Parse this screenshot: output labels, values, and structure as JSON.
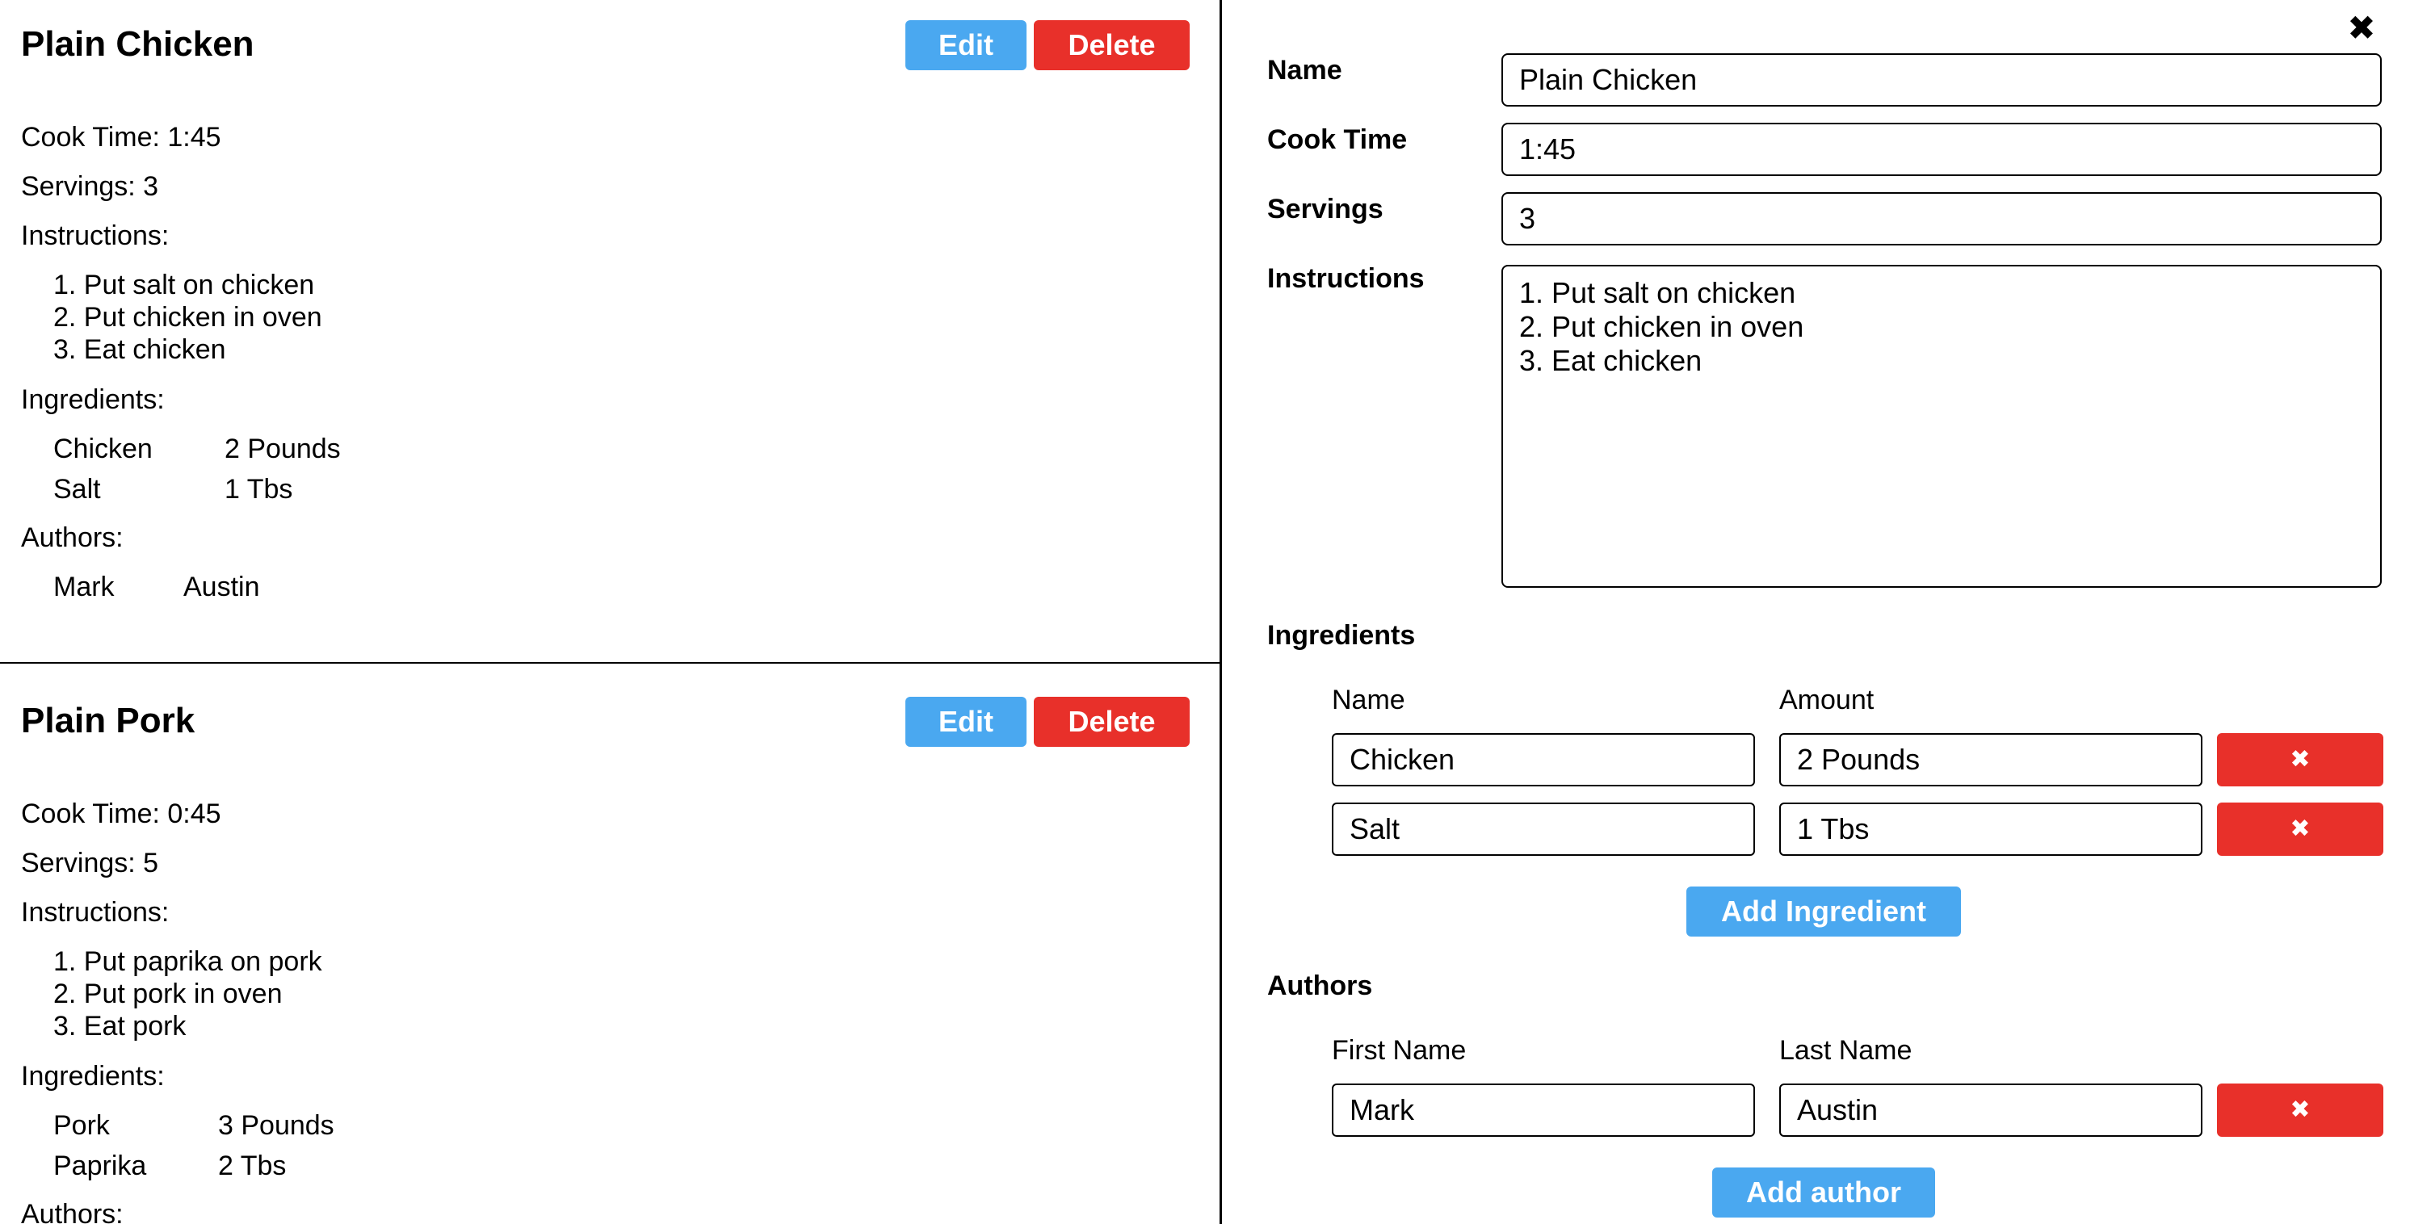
{
  "recipes": [
    {
      "title": "Plain Chicken",
      "edit_label": "Edit",
      "delete_label": "Delete",
      "cook_time": "Cook Time: 1:45",
      "servings": "Servings: 3",
      "instructions_label": "Instructions:",
      "steps": [
        "1. Put salt on chicken",
        "2. Put chicken in oven",
        "3. Eat chicken"
      ],
      "ingredients_label": "Ingredients:",
      "ingredients": [
        {
          "name": "Chicken",
          "amount": "2 Pounds"
        },
        {
          "name": "Salt",
          "amount": "1 Tbs"
        }
      ],
      "authors_label": "Authors:",
      "authors": [
        {
          "first": "Mark",
          "last": "Austin"
        }
      ]
    },
    {
      "title": "Plain Pork",
      "edit_label": "Edit",
      "delete_label": "Delete",
      "cook_time": "Cook Time: 0:45",
      "servings": "Servings: 5",
      "instructions_label": "Instructions:",
      "steps": [
        "1. Put paprika on pork",
        "2. Put pork in oven",
        "3. Eat pork"
      ],
      "ingredients_label": "Ingredients:",
      "ingredients": [
        {
          "name": "Pork",
          "amount": "3 Pounds"
        },
        {
          "name": "Paprika",
          "amount": "2 Tbs"
        }
      ],
      "authors_label": "Authors:"
    }
  ],
  "edit_form": {
    "close_icon": "✖",
    "name_label": "Name",
    "name_value": "Plain Chicken",
    "cook_time_label": "Cook Time",
    "cook_time_value": "1:45",
    "servings_label": "Servings",
    "servings_value": "3",
    "instructions_label": "Instructions",
    "instructions_value": "1. Put salt on chicken\n2. Put chicken in oven\n3. Eat chicken",
    "ingredients_section": "Ingredients",
    "ingredient_name_header": "Name",
    "ingredient_amount_header": "Amount",
    "ingredients": [
      {
        "name": "Chicken",
        "amount": "2 Pounds"
      },
      {
        "name": "Salt",
        "amount": "1 Tbs"
      }
    ],
    "remove_icon": "✖",
    "add_ingredient_label": "Add Ingredient",
    "authors_section": "Authors",
    "first_name_header": "First Name",
    "last_name_header": "Last Name",
    "authors": [
      {
        "first": "Mark",
        "last": "Austin"
      }
    ],
    "add_author_label": "Add author"
  },
  "colors": {
    "edit_button": "#4aa8f0",
    "delete_button": "#e8302a"
  }
}
